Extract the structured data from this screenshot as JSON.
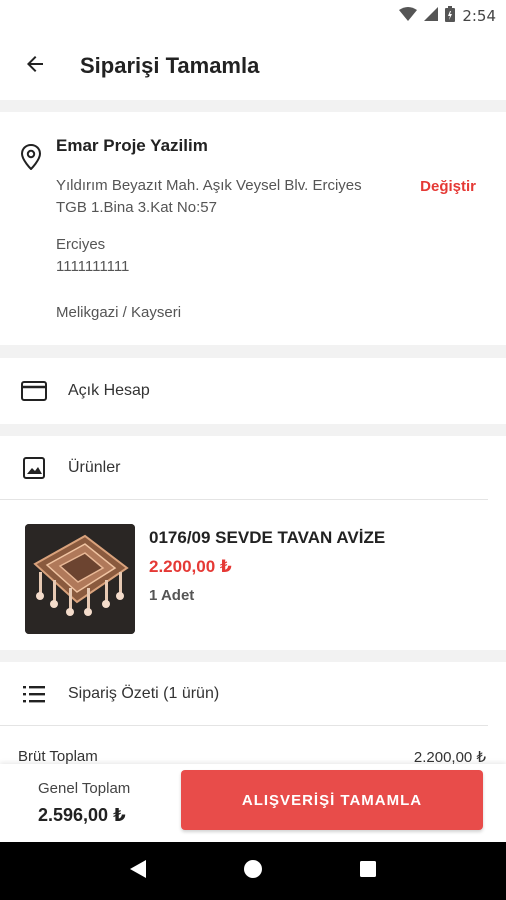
{
  "status_bar": {
    "time": "2:54"
  },
  "app_bar": {
    "title": "Siparişi Tamamla"
  },
  "address": {
    "name": "Emar Proje Yazilim",
    "street_line1": "Yıldırım Beyazıt Mah. Aşık Veysel Blv. Erciyes",
    "street_line2": "TGB 1.Bina 3.Kat No:57",
    "contact_name": "Erciyes",
    "phone": "1111111111",
    "district_city": "Melikgazi / Kayseri",
    "change_label": "Değiştir"
  },
  "payment": {
    "method": "Açık Hesap"
  },
  "products": {
    "section_title": "Ürünler",
    "items": [
      {
        "title": "0176/09 SEVDE TAVAN AVİZE",
        "price": "2.200,00 ₺",
        "quantity": "1 Adet"
      }
    ]
  },
  "summary": {
    "section_title": "Sipariş Özeti (1 ürün)",
    "gross_label": "Brüt Toplam",
    "gross_value": "2.200,00 ₺"
  },
  "bottom_bar": {
    "total_label": "Genel Toplam",
    "total_value": "2.596,00 ₺",
    "checkout_label": "ALIŞVERİŞİ TAMAMLA"
  },
  "colors": {
    "accent": "#e84c4a",
    "price": "#e53935"
  }
}
